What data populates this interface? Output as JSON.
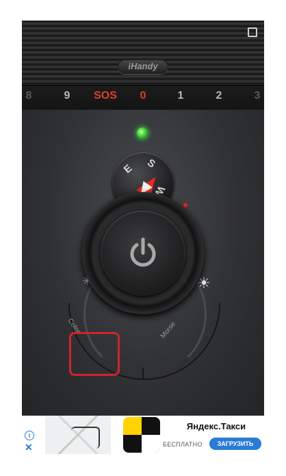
{
  "app": {
    "brand": "iHandy"
  },
  "dial": {
    "ticks": [
      "8",
      "9",
      "SOS",
      "0",
      "1",
      "2",
      "3"
    ]
  },
  "compass": {
    "s": "S",
    "e": "E",
    "w": "W",
    "n": "N"
  },
  "modes": {
    "color_label": "Color",
    "morse_label": "Morse"
  },
  "ad": {
    "title": "Яндекс.Такси",
    "free_label": "БЕСПЛАТНО",
    "install_label": "ЗАГРУЗИТЬ",
    "info_glyph": "i",
    "close_glyph": "✕"
  },
  "colors": {
    "led": "#3ed23a",
    "accent_red": "#e0412b",
    "highlight": "#d1232a",
    "ad_button": "#2b7bd6"
  },
  "icons": [
    "exit-fullscreen-icon",
    "power-icon",
    "brightness-low-icon",
    "brightness-high-icon",
    "compass-needle-icon"
  ]
}
